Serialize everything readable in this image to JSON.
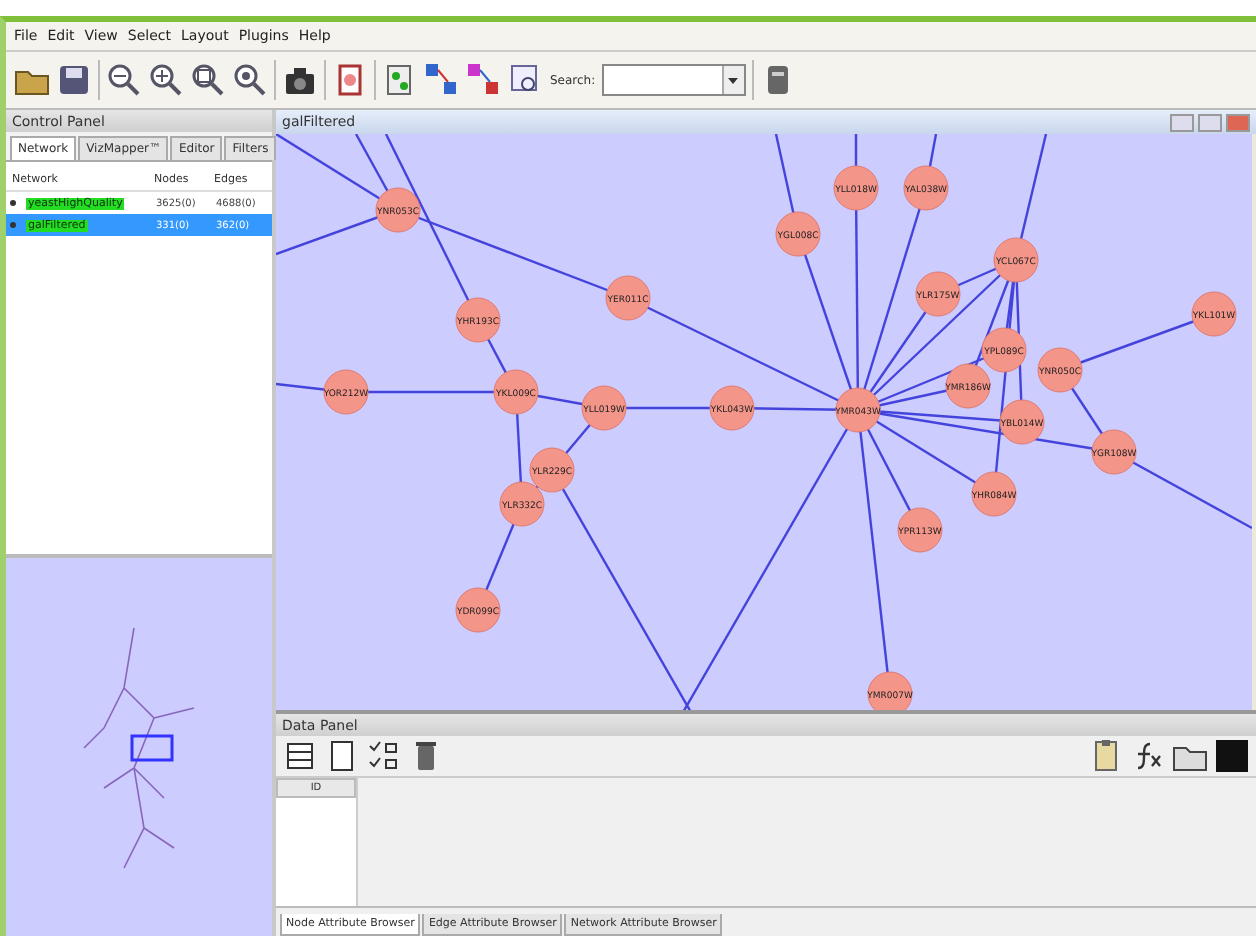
{
  "menu": [
    "File",
    "Edit",
    "View",
    "Select",
    "Layout",
    "Plugins",
    "Help"
  ],
  "toolbar": {
    "search_label": "Search:"
  },
  "control_panel": {
    "title": "Control Panel",
    "tabs": [
      {
        "label": "Network",
        "selected": true
      },
      {
        "label": "VizMapper™",
        "selected": false
      },
      {
        "label": "Editor",
        "selected": false
      },
      {
        "label": "Filters",
        "selected": false
      }
    ],
    "columns": [
      "Network",
      "Nodes",
      "Edges"
    ],
    "rows": [
      {
        "name": "yeastHighQuality",
        "nodes": "3625(0)",
        "edges": "4688(0)",
        "selected": false
      },
      {
        "name": "galFiltered",
        "nodes": "331(0)",
        "edges": "362(0)",
        "selected": true
      }
    ]
  },
  "network_view": {
    "title": "galFiltered",
    "nodes": [
      "YNR053C",
      "YER011C",
      "YHR193C",
      "YOR212W",
      "YKL009C",
      "YLL019W",
      "YKL043W",
      "YLR229C",
      "YLR332C",
      "YDR099C",
      "YGL008C",
      "YLL018W",
      "YAL038W",
      "YCL067C",
      "YLR175W",
      "YMR043W",
      "YPL089C",
      "YMR186W",
      "YNR050C",
      "YBL014W",
      "YGR108W",
      "YKL101W",
      "YHR084W",
      "YPR113W",
      "YMR007W"
    ]
  },
  "data_panel": {
    "title": "Data Panel",
    "column": "ID",
    "tabs": [
      {
        "label": "Node Attribute Browser",
        "selected": true
      },
      {
        "label": "Edge Attribute Browser",
        "selected": false
      },
      {
        "label": "Network Attribute Browser",
        "selected": false
      }
    ]
  }
}
